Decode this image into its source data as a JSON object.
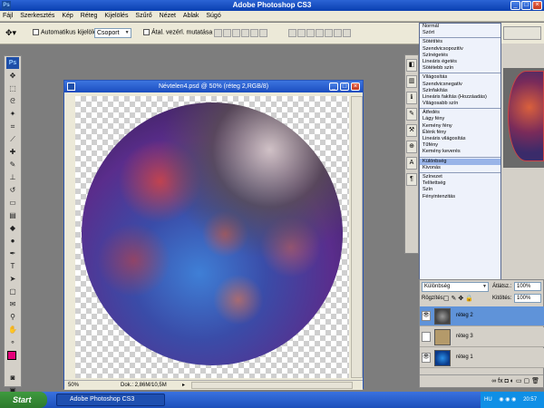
{
  "app": {
    "title": "Adobe Photoshop CS3",
    "logo": "Ps"
  },
  "menu": [
    "Fájl",
    "Szerkesztés",
    "Kép",
    "Réteg",
    "Kijelölés",
    "Szűrő",
    "Nézet",
    "Ablak",
    "Súgó"
  ],
  "options": {
    "auto_select_label": "Automatikus kijelölés:",
    "auto_select_value": "Csoport",
    "transform_label": "Átal. vezérl. mutatása"
  },
  "document": {
    "title": "Névtelen4.psd @ 50% (réteg 2,RGB/8)",
    "zoom": "50%",
    "doc_info": "Dok.: 2,86M/10,5M"
  },
  "blend_modes": {
    "groups": [
      [
        "Normál",
        "Szórt"
      ],
      [
        "Sötétítés",
        "Szendvicsopozitív",
        "Színégetés",
        "Lineáris égetés",
        "Sötétebb szín"
      ],
      [
        "Világosítás",
        "Szendvicsnegatív",
        "Színfakítás",
        "Lineáris fakítás (Hozzáadás)",
        "Világosabb szín"
      ],
      [
        "Átfedés",
        "Lágy fény",
        "Kemény fény",
        "Élénk fény",
        "Lineáris világosítás",
        "Tűfény",
        "Kemény keverés"
      ],
      [
        "Különbség",
        "Kivonás"
      ],
      [
        "Színezet",
        "Telítettség",
        "Szín",
        "Fényintenzitás"
      ]
    ],
    "selected": "Különbség"
  },
  "layers_panel": {
    "blend_mode": "Különbség",
    "opacity_label": "Átlátsz.:",
    "opacity": "100%",
    "lock_label": "Rögzítés:",
    "fill_label": "Kitöltés:",
    "fill": "100%",
    "layers": [
      {
        "name": "réteg 2",
        "active": true,
        "visible": true
      },
      {
        "name": "réteg 3",
        "active": false,
        "visible": false
      },
      {
        "name": "réteg 1",
        "active": false,
        "visible": true
      }
    ]
  },
  "taskbar": {
    "start": "Start",
    "task": "Adobe Photoshop CS3",
    "lang": "HU",
    "time": "20:57"
  }
}
